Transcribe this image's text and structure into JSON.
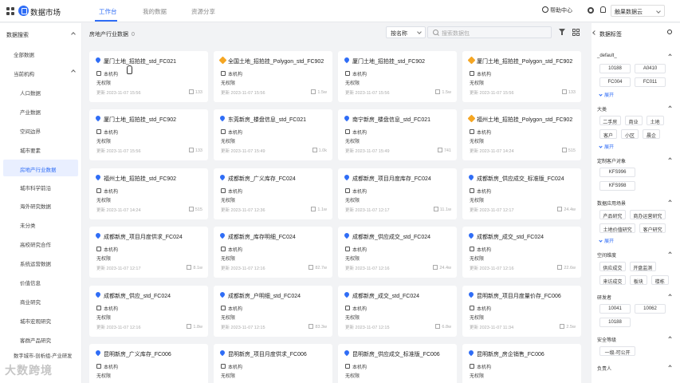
{
  "app": {
    "title": "数据市场",
    "tabs": [
      "工作台",
      "我的数据",
      "资源分享"
    ],
    "help": "帮助中心",
    "user": "触果数据云"
  },
  "sidebar": {
    "header": "数据搜索",
    "top": "全部数据",
    "group1": "当前机构",
    "items": [
      "人口数据",
      "产业数据",
      "空间边界",
      "城市要素",
      "房地产行业数据",
      "城市科学前沿",
      "海外研究数据",
      "未分类",
      "高校研究合作",
      "系统运营数据",
      "价值信息",
      "商业研究",
      "城市宏观研究",
      "客群产品研究"
    ],
    "active": "房地产行业数据",
    "group2": "数字城市-剖析组-产业研发"
  },
  "main": {
    "title": "房地产行业数据",
    "count": "0",
    "sort": "按名称",
    "search_placeholder": "搜索数据包",
    "cards": [
      {
        "icon": "pin",
        "title": "厦门土地_招拍挂_std_FC021",
        "org": "本机构",
        "perm": "无权限",
        "date": "更新 2023-11-07 15:56",
        "size": "133"
      },
      {
        "icon": "hex",
        "title": "全国土地_招拍挂_Polygon_std_FC902",
        "org": "本机构",
        "perm": "无权限",
        "date": "更新 2023-11-07 15:56",
        "size": "1.5w"
      },
      {
        "icon": "pin",
        "title": "厦门土地_招拍挂_std_FC902",
        "org": "本机构",
        "perm": "无权限",
        "date": "更新 2023-11-07 15:56",
        "size": "1.5w"
      },
      {
        "icon": "hex",
        "title": "厦门土地_招拍挂_Polygon_std_FC902",
        "org": "本机构",
        "perm": "无权限",
        "date": "更新 2023-11-07 15:56",
        "size": "133"
      },
      {
        "icon": "pin",
        "title": "厦门土地_招拍挂_std_FC902",
        "org": "本机构",
        "perm": "无权限",
        "date": "更新 2023-11-07 15:56",
        "size": "133"
      },
      {
        "icon": "pin",
        "title": "东莞新房_楼盘信息_std_FC021",
        "org": "本机构",
        "perm": "无权限",
        "date": "更新 2023-11-07 15:49",
        "size": "1.0k"
      },
      {
        "icon": "pin",
        "title": "南宁新房_楼盘信息_std_FC021",
        "org": "本机构",
        "perm": "无权限",
        "date": "更新 2023-11-07 15:49",
        "size": "741"
      },
      {
        "icon": "hex",
        "title": "福州土地_招拍挂_Polygon_std_FC902",
        "org": "本机构",
        "perm": "无权限",
        "date": "更新 2023-11-07 14:24",
        "size": "515"
      },
      {
        "icon": "pin",
        "title": "福州土地_招拍挂_std_FC902",
        "org": "本机构",
        "perm": "无权限",
        "date": "更新 2023-11-07 14:24",
        "size": "515"
      },
      {
        "icon": "pin",
        "title": "成都新房_广义库存_FC024",
        "org": "本机构",
        "perm": "无权限",
        "date": "更新 2023-11-07 12:36",
        "size": "1.1w"
      },
      {
        "icon": "pin",
        "title": "成都新房_项目月度库存_FC024",
        "org": "本机构",
        "perm": "无权限",
        "date": "更新 2023-11-07 12:17",
        "size": "11.1w"
      },
      {
        "icon": "pin",
        "title": "成都新房_供应成交_标准版_FC024",
        "org": "本机构",
        "perm": "无权限",
        "date": "更新 2023-11-07 12:17",
        "size": "24.4w"
      },
      {
        "icon": "pin",
        "title": "成都新房_项目月度供求_FC024",
        "org": "本机构",
        "perm": "无权限",
        "date": "更新 2023-11-07 12:17",
        "size": "8.1w"
      },
      {
        "icon": "pin",
        "title": "成都新房_库存明细_FC024",
        "org": "本机构",
        "perm": "无权限",
        "date": "更新 2023-11-07 12:16",
        "size": "82.7w"
      },
      {
        "icon": "pin",
        "title": "成都新房_供应成交_std_FC024",
        "org": "本机构",
        "perm": "无权限",
        "date": "更新 2023-11-07 12:16",
        "size": "24.4w"
      },
      {
        "icon": "pin",
        "title": "成都新房_成交_std_FC024",
        "org": "本机构",
        "perm": "无权限",
        "date": "更新 2023-11-07 12:16",
        "size": "22.6w"
      },
      {
        "icon": "pin",
        "title": "成都新房_供应_std_FC024",
        "org": "本机构",
        "perm": "无权限",
        "date": "更新 2023-11-07 12:16",
        "size": "1.8w"
      },
      {
        "icon": "pin",
        "title": "成都新房_户明细_std_FC024",
        "org": "本机构",
        "perm": "无权限",
        "date": "更新 2023-11-07 12:15",
        "size": "83.3w"
      },
      {
        "icon": "pin",
        "title": "成都新房_成交_std_FC024",
        "org": "本机构",
        "perm": "无权限",
        "date": "更新 2023-11-07 12:15",
        "size": "6.8w"
      },
      {
        "icon": "pin",
        "title": "昆明新房_项目月度量价存_FC006",
        "org": "本机构",
        "perm": "无权限",
        "date": "更新 2023-11-07 11:34",
        "size": "2.5w"
      },
      {
        "icon": "pin",
        "title": "昆明新房_广义库存_FC006",
        "org": "本机构",
        "perm": "无权限",
        "date": "",
        "size": ""
      },
      {
        "icon": "pin",
        "title": "昆明新房_项目月度供求_FC006",
        "org": "本机构",
        "perm": "无权限",
        "date": "",
        "size": ""
      },
      {
        "icon": "pin",
        "title": "昆明新房_供应成交_标准版_FC006",
        "org": "本机构",
        "perm": "无权限",
        "date": "",
        "size": ""
      },
      {
        "icon": "pin",
        "title": "昆明新房_房企销售_FC006",
        "org": "本机构",
        "perm": "无权限",
        "date": "",
        "size": ""
      }
    ]
  },
  "tags_panel": {
    "title": "数据标签",
    "sections": [
      {
        "name": "_default_",
        "tags": [
          "10188",
          "A0410",
          "FC004",
          "FC011"
        ],
        "more": "展开"
      },
      {
        "name": "大类",
        "tags": [
          "二手房",
          "商业",
          "土地",
          "客户",
          "小区",
          "晨企"
        ],
        "more": "展开"
      },
      {
        "name": "定制客户对象",
        "tags": [
          "KFS996",
          "KFS998"
        ]
      },
      {
        "name": "数据应用场景",
        "tags": [
          "产品研究",
          "商办运营研究",
          "土地价值研究",
          "客户研究"
        ],
        "more": "展开"
      },
      {
        "name": "空间维度",
        "tags": [
          "供应成交",
          "开盘监测",
          "来访成交",
          "板块",
          "楼栋"
        ]
      },
      {
        "name": "研发者",
        "tags": [
          "10041",
          "10062",
          "10188"
        ]
      },
      {
        "name": "安全等级",
        "tags": [
          "一级-可公开"
        ]
      },
      {
        "name": "负责人",
        "tags": []
      }
    ]
  },
  "watermark": "大数跨境"
}
